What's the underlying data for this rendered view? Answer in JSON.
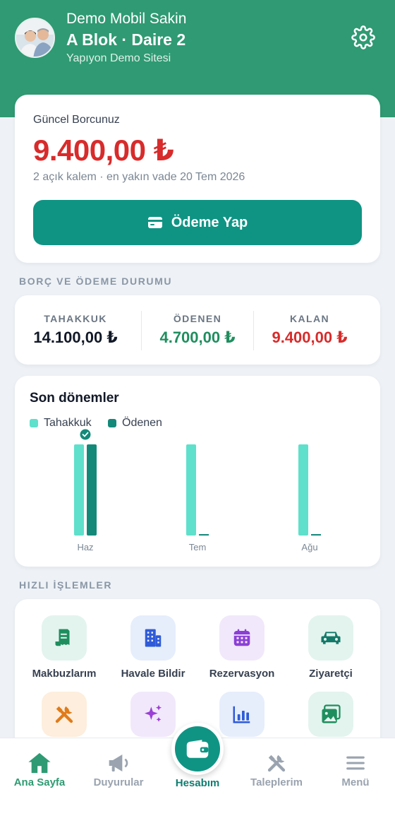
{
  "header": {
    "user_name": "Demo Mobil Sakin",
    "unit": "A Blok · Daire 2",
    "site": "Yapıyon Demo Sitesi",
    "settings_icon": "gear-icon"
  },
  "debt": {
    "title": "Güncel Borcunuz",
    "amount": "9.400,00 ₺",
    "subtitle": "2 açık kalem · en yakın vade 20 Tem 2026",
    "pay_button_label": "Ödeme Yap",
    "amount_color": "#d82b2b"
  },
  "status": {
    "section_label": "BORÇ VE ÖDEME DURUMU",
    "items": [
      {
        "label": "TAHAKKUK",
        "value": "14.100,00 ₺",
        "color": "#111827"
      },
      {
        "label": "ÖDENEN",
        "value": "4.700,00 ₺",
        "color": "#1f8e5e"
      },
      {
        "label": "KALAN",
        "value": "9.400,00 ₺",
        "color": "#d82b2b"
      }
    ]
  },
  "periods": {
    "title": "Son dönemler",
    "legend": [
      {
        "name": "Tahakkuk",
        "color": "#5fe0cc"
      },
      {
        "name": "Ödenen",
        "color": "#13897a"
      }
    ]
  },
  "chart_data": {
    "type": "bar",
    "title": "Son dönemler",
    "categories": [
      "Haz",
      "Tem",
      "Ağu"
    ],
    "series": [
      {
        "name": "Tahakkuk",
        "values": [
          4700,
          4700,
          4700
        ]
      },
      {
        "name": "Ödenen",
        "values": [
          4700,
          0,
          0
        ]
      }
    ],
    "paid_check": [
      true,
      false,
      false
    ],
    "legend_position": "top-left",
    "grid": false
  },
  "quick_actions": {
    "section_label": "HIZLI İŞLEMLER",
    "items": [
      {
        "label": "Makbuzlarım",
        "icon": "receipt-icon",
        "bg": "#e3f4ee",
        "fg": "#1f8e5e"
      },
      {
        "label": "Havale Bildir",
        "icon": "building-icon",
        "bg": "#e6eefc",
        "fg": "#2f5bd8"
      },
      {
        "label": "Rezervasyon",
        "icon": "calendar-icon",
        "bg": "#f1e8fb",
        "fg": "#8b3fd6"
      },
      {
        "label": "Ziyaretçi",
        "icon": "car-icon",
        "bg": "#e3f4ee",
        "fg": "#137a6a"
      },
      {
        "label": "",
        "icon": "tools-icon",
        "bg": "#fdeedd",
        "fg": "#e07b1a"
      },
      {
        "label": "",
        "icon": "sparkles-icon",
        "bg": "#f1e8fb",
        "fg": "#9b3fd6"
      },
      {
        "label": "",
        "icon": "bar-chart-icon",
        "bg": "#e6eefc",
        "fg": "#2f5bd8"
      },
      {
        "label": "",
        "icon": "image-icon",
        "bg": "#e3f4ee",
        "fg": "#1f8e5e"
      }
    ]
  },
  "tabbar": {
    "items": [
      {
        "label": "Ana Sayfa",
        "icon": "home-icon",
        "active": true
      },
      {
        "label": "Duyurular",
        "icon": "megaphone-icon",
        "active": false
      },
      {
        "label": "Hesabım",
        "icon": "wallet-icon",
        "active": false
      },
      {
        "label": "Taleplerim",
        "icon": "tools-icon",
        "active": false
      },
      {
        "label": "Menü",
        "icon": "menu-icon",
        "active": false
      }
    ]
  }
}
